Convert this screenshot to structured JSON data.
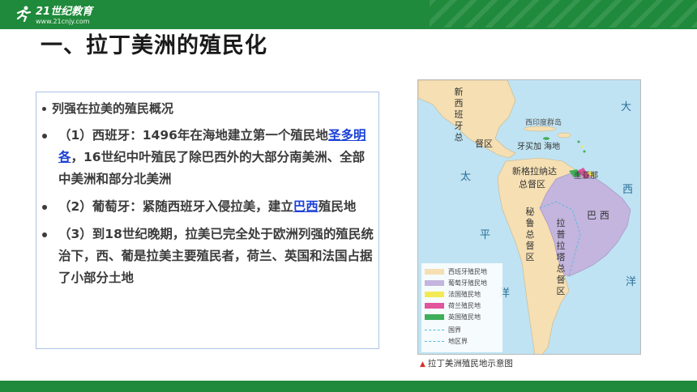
{
  "header": {
    "logo_text": "21世纪教育",
    "logo_sub": "www.21cnjy.com"
  },
  "title": "一、拉丁美洲的殖民化",
  "content": {
    "heading": "列强在拉美的殖民概况",
    "spain_prefix": "（1）西班牙：1496年在海地建立第一个殖民地",
    "spain_link": "圣多明各",
    "spain_suffix": "，16世纪中叶殖民了除巴西外的大部分南美洲、全部中美洲和部分北美洲",
    "portugal_prefix": "（2）葡萄牙：紧随西班牙入侵拉美，建立",
    "portugal_link": "巴西",
    "portugal_suffix": "殖民地",
    "late_18th": "（3）到18世纪晚期，拉美已完全处于欧洲列强的殖民统治下，西、葡是拉美主要殖民者，荷兰、英国和法国占据了小部分土地"
  },
  "map": {
    "labels": {
      "new_spain": [
        "新",
        "西",
        "班",
        "牙",
        "总",
        "督",
        "区"
      ],
      "west_indies": "西印度群岛",
      "haiti": "牙买加 海地",
      "new_granada": "新格拉纳达",
      "new_granada_2": "总督区",
      "guiana": "圭亚那",
      "peru": [
        "秘",
        "鲁",
        "总",
        "督",
        "区"
      ],
      "brazil": "巴  西",
      "la_plata": [
        "拉",
        "普",
        "拉",
        "塔",
        "总",
        "督",
        "区"
      ],
      "ocean_pacific": [
        "太",
        "平",
        "洋"
      ],
      "ocean_atlantic": [
        "大",
        "西",
        "洋"
      ],
      "pacific_left": "太"
    },
    "legend": [
      {
        "label": "西班牙殖民地",
        "color": "#f5dfb3"
      },
      {
        "label": "葡萄牙殖民地",
        "color": "#c3b5de"
      },
      {
        "label": "法国殖民地",
        "color": "#f2ea55"
      },
      {
        "label": "荷兰殖民地",
        "color": "#e0559c"
      },
      {
        "label": "英国殖民地",
        "color": "#3fae5a"
      },
      {
        "label": "国界",
        "color": "#50b8e0"
      },
      {
        "label": "地区界",
        "color": "#50b8e0"
      }
    ],
    "caption": "拉丁美洲殖民地示意图"
  },
  "colors": {
    "brand_green": "#1f8a3b",
    "link_blue": "#1a3fd6",
    "box_border": "#aac4e6",
    "ocean": "#bfe3f2"
  }
}
